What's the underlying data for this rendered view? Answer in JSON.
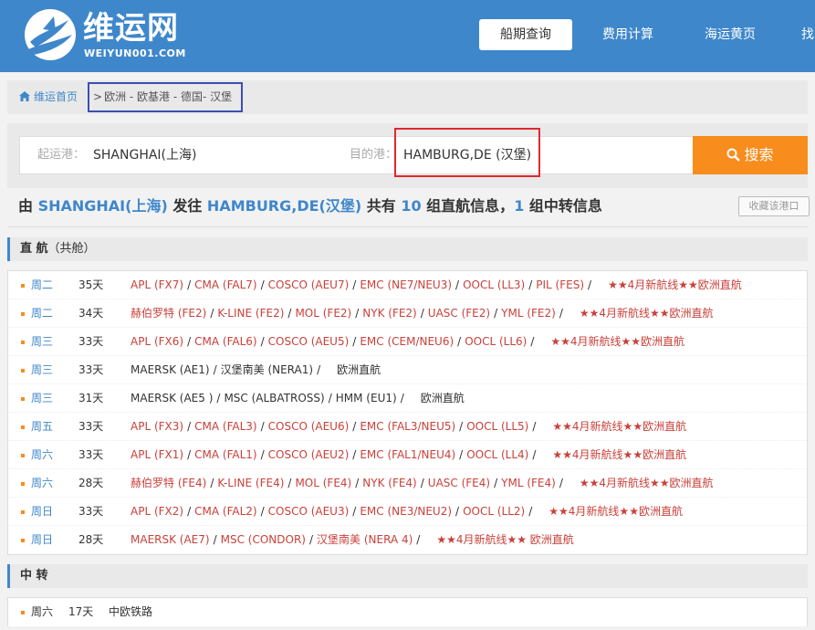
{
  "brand": {
    "name": "维运网",
    "domain": "WEIYUN001.COM"
  },
  "nav": [
    {
      "label": "船期查询",
      "active": true
    },
    {
      "label": "费用计算",
      "active": false
    },
    {
      "label": "海运黄页",
      "active": false
    },
    {
      "label": "找",
      "active": false
    }
  ],
  "breadcrumb": {
    "home": "维运首页",
    "sep": ">",
    "path": "欧洲 - 欧基港 - 德国- 汉堡"
  },
  "search": {
    "origin_label": "起运港：",
    "origin_value": "SHANGHAI(上海)",
    "dest_label": "目的港：",
    "dest_value": "HAMBURG,DE (汉堡)",
    "button_label": "搜索"
  },
  "summary": {
    "p1": "由 ",
    "origin": "SHANGHAI(上海)",
    "p2": " 发往 ",
    "dest": "HAMBURG,DE(汉堡)",
    "p3": " 共有 ",
    "direct_count": "10",
    "p4": " 组直航信息，",
    "transfer_count": "1",
    "p5": " 组中转信息",
    "fav_label": "收藏该港口"
  },
  "direct": {
    "title": "直 航",
    "subtitle": "（共舱）",
    "rows": [
      {
        "day": "周二",
        "days": "35天",
        "dark": false,
        "carriers": [
          "APL (FX7)",
          "CMA (FAL7)",
          "COSCO (AEU7)",
          "EMC (NE7/NEU3)",
          "OOCL (LL3)",
          "PIL (FES)"
        ],
        "remark": "★★4月新航线★★欧洲直航"
      },
      {
        "day": "周二",
        "days": "34天",
        "dark": false,
        "carriers": [
          "赫伯罗特 (FE2)",
          "K-LINE (FE2)",
          "MOL (FE2)",
          "NYK (FE2)",
          "UASC (FE2)",
          "YML (FE2)"
        ],
        "remark": "★★4月新航线★★欧洲直航"
      },
      {
        "day": "周三",
        "days": "33天",
        "dark": false,
        "carriers": [
          "APL (FX6)",
          "CMA (FAL6)",
          "COSCO (AEU5)",
          "EMC (CEM/NEU6)",
          "OOCL (LL6)"
        ],
        "remark": "★★4月新航线★★欧洲直航"
      },
      {
        "day": "周三",
        "days": "33天",
        "dark": true,
        "carriers": [
          "MAERSK (AE1)",
          "汉堡南美 (NERA1)"
        ],
        "remark": "欧洲直航"
      },
      {
        "day": "周三",
        "days": "31天",
        "dark": true,
        "carriers": [
          "MAERSK (AE5 )",
          "MSC (ALBATROSS)",
          "HMM (EU1)"
        ],
        "remark": "欧洲直航"
      },
      {
        "day": "周五",
        "days": "33天",
        "dark": false,
        "carriers": [
          "APL (FX3)",
          "CMA (FAL3)",
          "COSCO (AEU6)",
          "EMC (FAL3/NEU5)",
          "OOCL (LL5)"
        ],
        "remark": "★★4月新航线★★欧洲直航"
      },
      {
        "day": "周六",
        "days": "33天",
        "dark": false,
        "carriers": [
          "APL (FX1)",
          "CMA (FAL1)",
          "COSCO (AEU2)",
          "EMC (FAL1/NEU4)",
          "OOCL (LL4)"
        ],
        "remark": "★★4月新航线★★欧洲直航"
      },
      {
        "day": "周六",
        "days": "28天",
        "dark": false,
        "carriers": [
          "赫伯罗特 (FE4)",
          "K-LINE (FE4)",
          "MOL (FE4)",
          "NYK (FE4)",
          "UASC (FE4)",
          "YML (FE4)"
        ],
        "remark": "★★4月新航线★★欧洲直航"
      },
      {
        "day": "周日",
        "days": "33天",
        "dark": false,
        "carriers": [
          "APL (FX2)",
          "CMA (FAL2)",
          "COSCO (AEU3)",
          "EMC (NE3/NEU2)",
          "OOCL (LL2)"
        ],
        "remark": "★★4月新航线★★欧洲直航"
      },
      {
        "day": "周日",
        "days": "28天",
        "dark": false,
        "carriers": [
          "MAERSK (AE7)",
          "MSC (CONDOR)",
          "汉堡南美 (NERA 4)"
        ],
        "remark": "★★4月新航线★★ 欧洲直航"
      }
    ]
  },
  "transfer": {
    "title": "中 转",
    "rows": [
      {
        "day": "周六",
        "days": "17天",
        "route": "中欧铁路"
      }
    ]
  },
  "colors": {
    "brand_blue": "#3f87cb",
    "accent_orange": "#f88c1c",
    "carrier_red": "#c9413a",
    "highlight_red": "#e0282f",
    "highlight_blue": "#3b4fb0"
  }
}
